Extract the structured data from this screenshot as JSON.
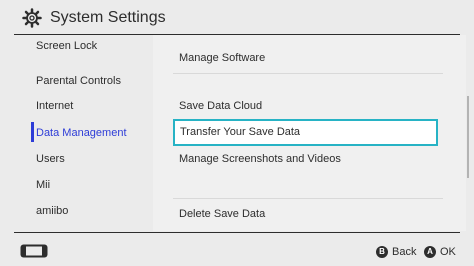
{
  "header": {
    "title": "System Settings",
    "icon": "gear-icon"
  },
  "sidebar": {
    "items": [
      {
        "label": "Screen Lock"
      },
      {
        "label": "Parental Controls"
      },
      {
        "label": "Internet"
      },
      {
        "label": "Data Management"
      },
      {
        "label": "Users"
      },
      {
        "label": "Mii"
      },
      {
        "label": "amiibo"
      }
    ],
    "selected": "Data Management"
  },
  "main": {
    "items": [
      {
        "label": "Manage Software"
      },
      {
        "label": "Save Data Cloud"
      },
      {
        "label": "Transfer Your Save Data"
      },
      {
        "label": "Manage Screenshots and Videos"
      },
      {
        "label": "Delete Save Data"
      }
    ],
    "focused": "Transfer Your Save Data"
  },
  "footer": {
    "back": {
      "glyph": "B",
      "label": "Back"
    },
    "ok": {
      "glyph": "A",
      "label": "OK"
    },
    "console_icon": "switch-console-icon"
  },
  "colors": {
    "accent": "#2d3cd7",
    "focus": "#27b3c5",
    "background": "#ebebeb",
    "panel": "#f0f0f0"
  }
}
